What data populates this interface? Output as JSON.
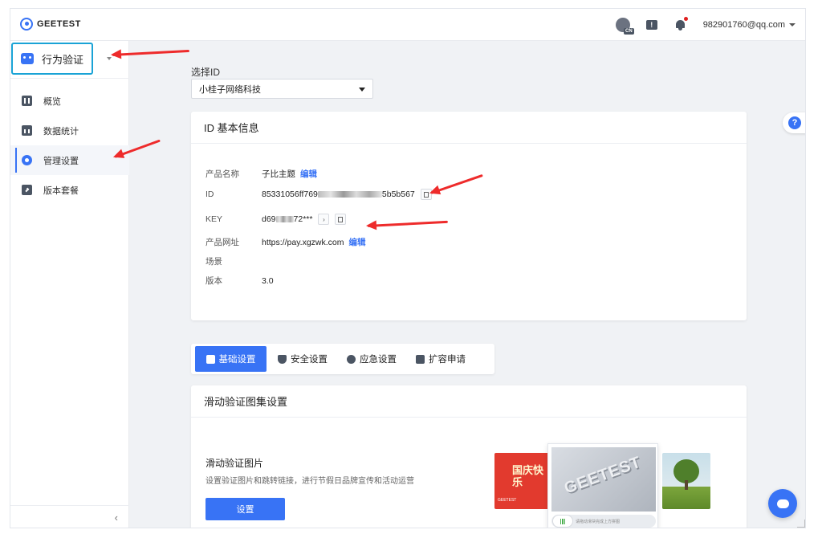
{
  "brand": {
    "name": "GEETEST"
  },
  "header": {
    "lang_badge": "CN",
    "msg_glyph": "!",
    "user_email": "982901760@qq.com",
    "accent_color": "#3873f5",
    "notification_dot_color": "#e02020"
  },
  "sidebar": {
    "product_label": "行为验证",
    "items": [
      {
        "label": "概览",
        "icon": "overview-icon"
      },
      {
        "label": "数据统计",
        "icon": "stats-icon"
      },
      {
        "label": "管理设置",
        "icon": "gear-icon",
        "active": true
      },
      {
        "label": "版本套餐",
        "icon": "package-icon"
      }
    ],
    "collapse_glyph": "‹"
  },
  "id_select": {
    "label": "选择ID",
    "value": "小桂子网络科技"
  },
  "info_card": {
    "title": "ID 基本信息",
    "rows": [
      {
        "key": "产品名称",
        "value": "子比主题",
        "link": "编辑"
      },
      {
        "key": "ID",
        "value_prefix": "85331056ff769",
        "value_suffix": "5b5b567"
      },
      {
        "key": "KEY",
        "value_prefix": "d69",
        "value_suffix": "72***",
        "reveal_glyph": "›"
      },
      {
        "key": "产品网址",
        "value": "https://pay.xgzwk.com",
        "link": "编辑"
      },
      {
        "key": "场景",
        "value": ""
      },
      {
        "key": "版本",
        "value": "3.0"
      }
    ]
  },
  "tabs": [
    {
      "label": "基础设置",
      "active": true
    },
    {
      "label": "安全设置"
    },
    {
      "label": "应急设置"
    },
    {
      "label": "扩容申请"
    }
  ],
  "slide_card": {
    "title": "滑动验证图集设置",
    "section_title": "滑动验证图片",
    "description": "设置验证图片和跳转链接，进行节假日品牌宣传和活动运营",
    "button": "设置",
    "poster_text": "国庆快乐",
    "poster_brand": "GEETEST",
    "captcha_text": "GEETEST",
    "captcha_hint": "请拖动滑块完成上方拼图"
  },
  "help_glyph": "?"
}
